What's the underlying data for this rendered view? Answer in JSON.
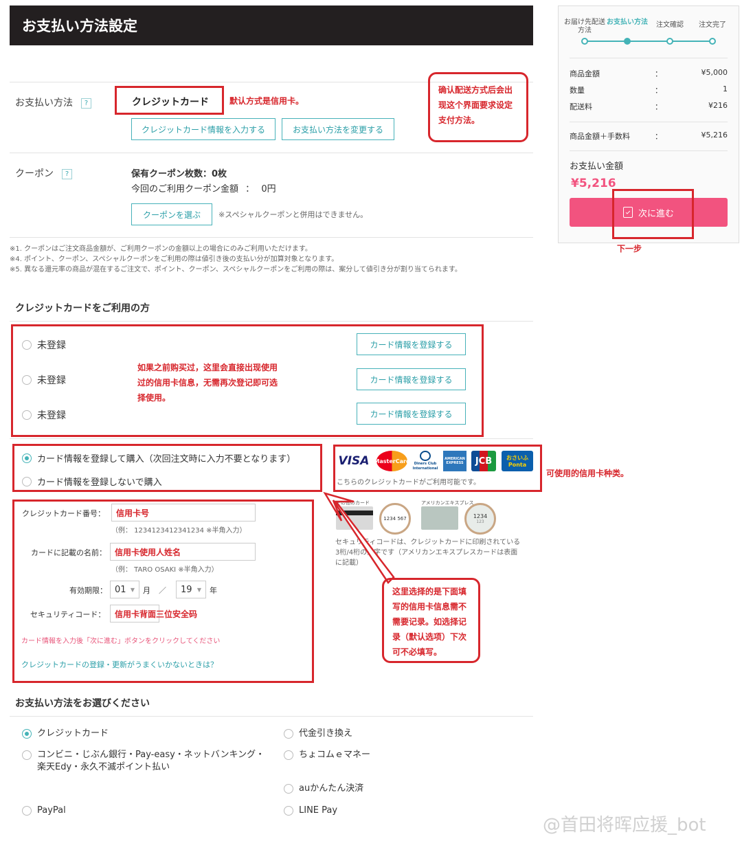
{
  "page_title": "お支払い方法設定",
  "payment": {
    "label": "お支払い方法",
    "help": "?",
    "method": "クレジットカード",
    "note": "默认方式是信用卡。",
    "btn_enter_card": "クレジットカード情報を入力する",
    "btn_change_method": "お支払い方法を変更する"
  },
  "callout_top": [
    "确认配送方式后会出",
    "现这个界面要求设定",
    "支付方法。"
  ],
  "coupon": {
    "label": "クーポン",
    "help": "?",
    "count_label": "保有クーポン枚数：",
    "count": "0枚",
    "amount_label": "今回のご利用クーポン金額",
    "amount_sep": "：",
    "amount": "0円",
    "btn": "クーポンを選ぶ",
    "note": "※スペシャルクーポンと併用はできません。"
  },
  "footnotes": [
    "※1. クーポンはご注文商品金額が、ご利用クーポンの金額以上の場合にのみご利用いただけます。",
    "※4. ポイント、クーポン、スペシャルクーポンをご利用の際は値引き後の支払い分が加算対象となります。",
    "※5. 異なる還元率の商品が混在するご注文で、ポイント、クーポン、スペシャルクーポンをご利用の際は、案分して値引き分が割り当てられます。"
  ],
  "credit_section": {
    "heading": "クレジットカードをご利用の方",
    "saved": [
      {
        "label": "未登録",
        "btn": "カード情報を登録する"
      },
      {
        "label": "未登録",
        "btn": "カード情報を登録する"
      },
      {
        "label": "未登録",
        "btn": "カード情報を登録する"
      }
    ],
    "saved_note": [
      "如果之前购买过，这里会直接出现使用",
      "过的信用卡信息，无需再次登记即可选",
      "择使用。"
    ],
    "register_yes": "カード情報を登録して購入（次回注文時に入力不要となります）",
    "register_no": "カード情報を登録しないで購入",
    "card_brands": [
      "VISA",
      "MasterCard",
      "Diners Club International",
      "AMERICAN EXPRESS",
      "JCB",
      "おさいふPonta"
    ],
    "brands_caption": "こちらのクレジットカードがご利用可能です。",
    "brands_note": "可使用的信用卡种类。",
    "form": {
      "number_label": "クレジットカード番号：",
      "number_value": "信用卡号",
      "number_hint": "（例： 1234123412341234 ※半角入力）",
      "name_label": "カードに記載の名前：",
      "name_value": "信用卡使用人姓名",
      "name_hint": "（例： TARO OSAKI ※半角入力）",
      "expiry_label": "有効期限：",
      "month": "01",
      "month_unit": "月",
      "slash": "／",
      "year": "19",
      "year_unit": "年",
      "security_label": "セキュリティコード：",
      "security_value": "信用卡背面三位安全码",
      "instruction": "カード情報を入力後「次に進む」ボタンをクリックしてください",
      "help_link": "クレジットカードの登録・更新がうまくいかないときは？"
    },
    "sec_card_labels": [
      "その他のカード",
      "アメリカンエキスプレス"
    ],
    "sec_card_digits": [
      "1234 567",
      "1234",
      "123"
    ],
    "sec_caption": [
      "セキュリティコードは、クレジットカードに印刷されている",
      "3桁/4桁の数字です（アメリカンエキスプレスカードは表面",
      "に記載）"
    ],
    "callout_register": [
      "这里选择的是下面填",
      "写的信用卡信息需不",
      "需要记录。如选择记",
      "录（默认选项）下次",
      "可不必填写。"
    ]
  },
  "methods": {
    "heading": "お支払い方法をお選びください",
    "left": [
      "クレジットカード",
      "コンビニ・じぶん銀行・Pay-easy・ネットバンキング・楽天Edy・永久不滅ポイント払い",
      "PayPal"
    ],
    "right": [
      "代金引き換え",
      "ちょコムｅマネー",
      "auかんたん決済",
      "LINE Pay"
    ]
  },
  "sidebar": {
    "steps": [
      "お届け先配送方法",
      "お支払い方法",
      "注文確認",
      "注文完了"
    ],
    "rows": [
      {
        "label": "商品金額",
        "value": "¥5,000"
      },
      {
        "label": "数量",
        "value": "1"
      },
      {
        "label": "配送料",
        "value": "¥216"
      }
    ],
    "colon": "：",
    "subtotal_label": "商品金額＋手数料",
    "subtotal_value": "¥5,216",
    "total_label": "お支払い金額",
    "total_value": "¥5,216",
    "next_btn": "次に進む",
    "next_note": "下一步"
  },
  "watermark": "@首田将晖应援_bot",
  "colors": {
    "accent": "#44b3b7",
    "pink": "#f2537f",
    "annotation": "#d7262c",
    "header": "#231f20"
  }
}
